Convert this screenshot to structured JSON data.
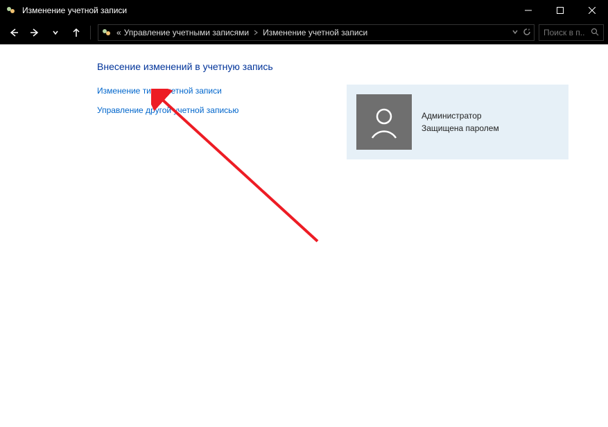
{
  "window": {
    "title": "Изменение учетной записи"
  },
  "breadcrumb": {
    "prefix": "«",
    "items": [
      "Управление учетными записями",
      "Изменение учетной записи"
    ]
  },
  "search": {
    "placeholder": "Поиск в п..."
  },
  "main": {
    "heading": "Внесение изменений в учетную запись",
    "links": [
      "Изменение типа учетной записи",
      "Управление другой учетной записью"
    ]
  },
  "user": {
    "role": "Администратор",
    "protection": "Защищена паролем"
  }
}
